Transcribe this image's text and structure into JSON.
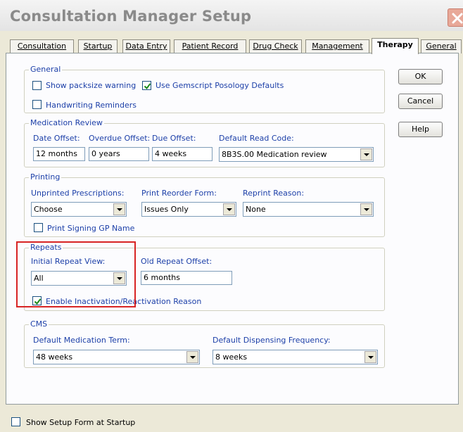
{
  "window": {
    "title": "Consultation Manager Setup"
  },
  "tabs": [
    {
      "label": "Consultation"
    },
    {
      "label": "Startup"
    },
    {
      "label": "Data Entry"
    },
    {
      "label": "Patient Record"
    },
    {
      "label": "Drug Check"
    },
    {
      "label": "Management"
    },
    {
      "label": "Therapy"
    },
    {
      "label": "General"
    }
  ],
  "active_tab": "Therapy",
  "buttons": {
    "ok": "OK",
    "cancel": "Cancel",
    "help": "Help"
  },
  "general": {
    "title": "General",
    "show_packsize": {
      "label": "Show packsize warning",
      "checked": false
    },
    "use_gemscript": {
      "label": "Use Gemscript Posology Defaults",
      "checked": true
    },
    "handwriting": {
      "label": "Handwriting Reminders",
      "checked": false
    }
  },
  "medication_review": {
    "title": "Medication Review",
    "date_offset": {
      "label": "Date Offset:",
      "value": "12 months"
    },
    "overdue_offset": {
      "label": "Overdue Offset:",
      "value": "0 years"
    },
    "due_offset": {
      "label": "Due Offset:",
      "value": "4 weeks"
    },
    "default_read_code": {
      "label": "Default Read Code:",
      "value": "8B3S.00 Medication review"
    }
  },
  "printing": {
    "title": "Printing",
    "unprinted": {
      "label": "Unprinted Prescriptions:",
      "value": "Choose"
    },
    "reorder_form": {
      "label": "Print Reorder Form:",
      "value": "Issues Only"
    },
    "reprint_reason": {
      "label": "Reprint Reason:",
      "value": "None"
    },
    "signing_gp": {
      "label": "Print Signing GP Name",
      "checked": false
    }
  },
  "repeats": {
    "title": "Repeats",
    "initial_view": {
      "label": "Initial Repeat View:",
      "value": "All"
    },
    "old_offset": {
      "label": "Old Repeat Offset:",
      "value": "6 months"
    },
    "enable_inactivation": {
      "label": "Enable Inactivation/Reactivation Reason",
      "checked": true
    }
  },
  "cms": {
    "title": "CMS",
    "default_term": {
      "label": "Default Medication Term:",
      "value": "48 weeks"
    },
    "dispensing_freq": {
      "label": "Default Dispensing Frequency:",
      "value": "8 weeks"
    }
  },
  "footer": {
    "show_setup": {
      "label": "Show Setup Form at Startup",
      "checked": false
    }
  },
  "colors": {
    "label_blue": "#1c3fa8",
    "highlight_red": "#d82424",
    "dialog_bg": "#ece9d8"
  }
}
